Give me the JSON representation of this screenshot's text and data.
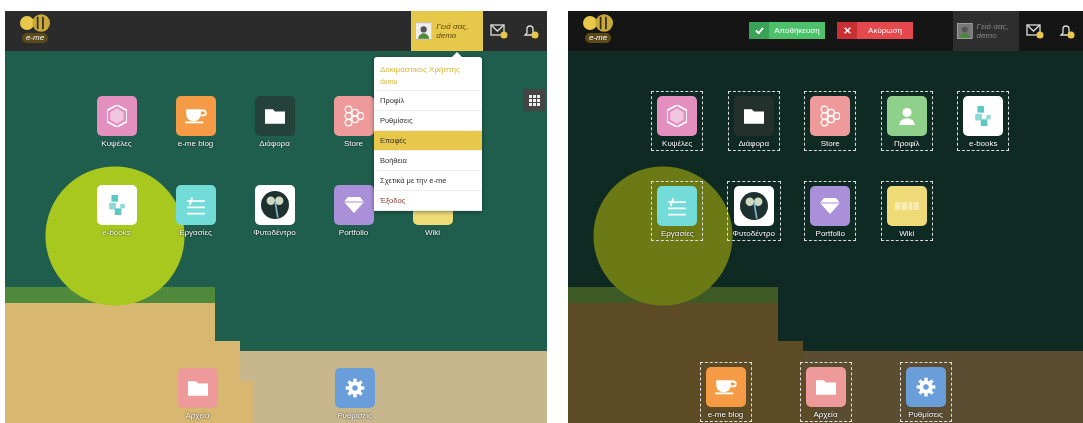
{
  "screens": [
    {
      "edit_mode": false,
      "dimmed": false,
      "logo_text": "e-me",
      "greeting": "Γειά σας, demo",
      "grid_button": true,
      "app_rows": [
        [
          {
            "label": "Κυψέλες",
            "kind": "hexagon",
            "color": "#e38fc0"
          },
          {
            "label": "e-me blog",
            "kind": "cup",
            "color": "#f59a45"
          },
          {
            "label": "Διάφορα",
            "kind": "folder",
            "color": "#24413a"
          },
          {
            "label": "Store",
            "kind": "honeycomb",
            "color": "#ee9a9a"
          }
        ],
        [
          {
            "label": "e-books",
            "kind": "ebook",
            "color": "#ffffff"
          },
          {
            "label": "Εργασίες",
            "kind": "tasks",
            "color": "#74dcd8"
          },
          {
            "label": "Φυτοδέντρο",
            "kind": "tree",
            "color": "#ffffff"
          },
          {
            "label": "Portfolio",
            "kind": "diamond",
            "color": "#a990d8"
          },
          {
            "label": "Wiki",
            "kind": "wiki",
            "color": "#efda78"
          }
        ]
      ],
      "dock": [
        {
          "label": "Αρχεία",
          "kind": "folder",
          "color": "#ee9a9a"
        },
        {
          "label": "Ρυθμίσεις",
          "kind": "gear",
          "color": "#6a9edb"
        }
      ],
      "user_menu": {
        "title": "Δοκιμαστικός Χρήστης",
        "subtitle": "demo",
        "items": [
          {
            "label": "Προφίλ",
            "selected": false
          },
          {
            "label": "Ρυθμίσεις",
            "selected": false
          },
          {
            "label": "Επαφές",
            "selected": true
          },
          {
            "label": "Βοήθεια",
            "selected": false
          },
          {
            "label": "Σχετικά με την e-me",
            "selected": false
          },
          {
            "label": "Έξοδος",
            "selected": false
          }
        ]
      }
    },
    {
      "edit_mode": true,
      "dimmed": true,
      "logo_text": "e-me",
      "greeting": "Γειά σας, demo",
      "grid_button": false,
      "actions": [
        {
          "label": "Αποθήκευση",
          "kind": "save"
        },
        {
          "label": "Ακύρωση",
          "kind": "cancel"
        }
      ],
      "app_rows": [
        [
          {
            "label": "Κυψέλες",
            "kind": "hexagon",
            "color": "#e38fc0"
          },
          {
            "label": "Διάφορα",
            "kind": "folder",
            "color": "#24302c"
          },
          {
            "label": "Store",
            "kind": "honeycomb",
            "color": "#ee9a9a"
          },
          {
            "label": "Προφίλ",
            "kind": "person",
            "color": "#8fd08a"
          },
          {
            "label": "e-books",
            "kind": "ebook",
            "color": "#ffffff"
          }
        ],
        [
          {
            "label": "Εργασίες",
            "kind": "tasks",
            "color": "#74dcd8"
          },
          {
            "label": "Φυτοδέντρο",
            "kind": "tree",
            "color": "#ffffff"
          },
          {
            "label": "Portfolio",
            "kind": "diamond",
            "color": "#a990d8"
          },
          {
            "label": "Wiki",
            "kind": "wiki",
            "color": "#efda78"
          }
        ]
      ],
      "dock": [
        {
          "label": "e-me blog",
          "kind": "cup",
          "color": "#f59a45"
        },
        {
          "label": "Αρχεία",
          "kind": "folder",
          "color": "#ee9a9a"
        },
        {
          "label": "Ρυθμίσεις",
          "kind": "gear",
          "color": "#6a9edb"
        }
      ]
    }
  ]
}
